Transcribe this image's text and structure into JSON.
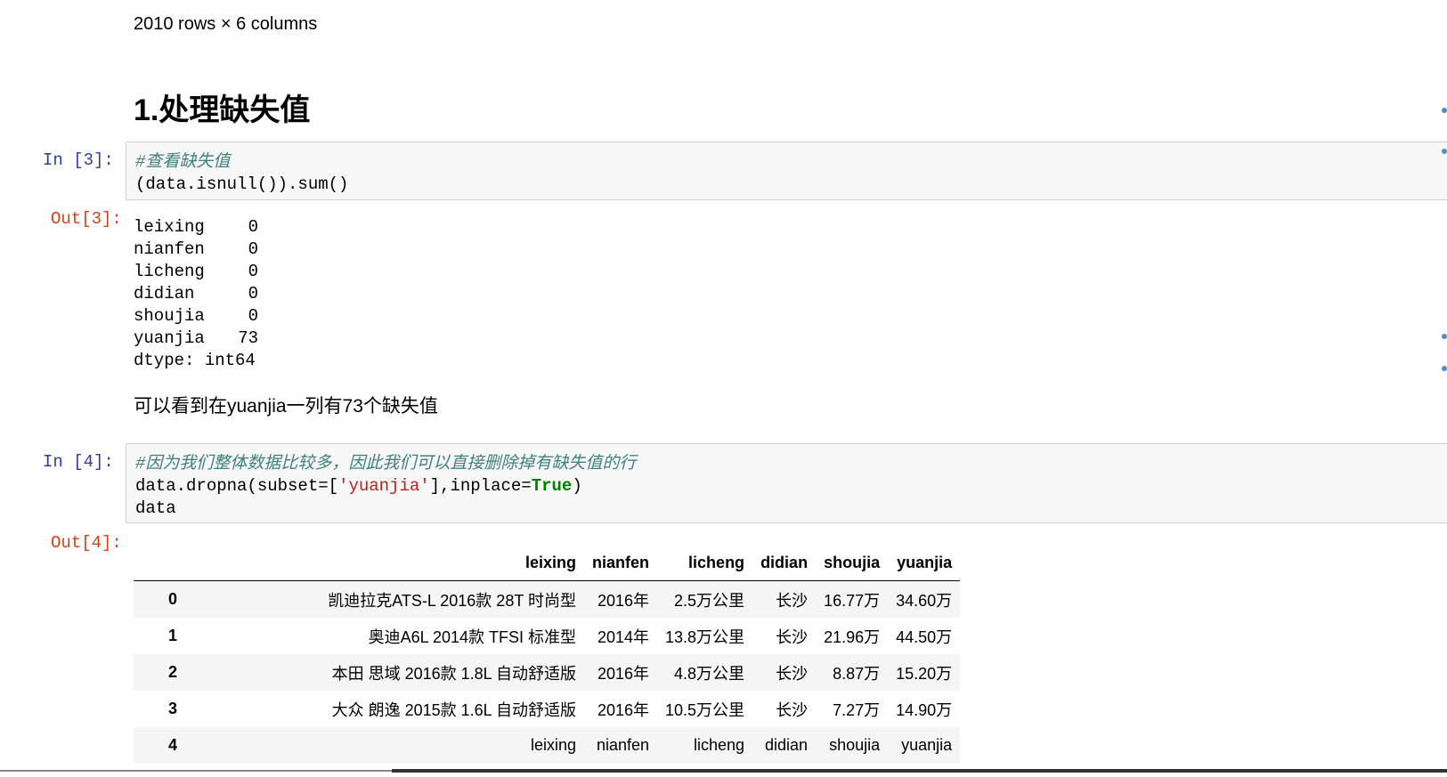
{
  "top_note": "2010 rows × 6 columns",
  "section_heading": "1.处理缺失值",
  "cell3": {
    "in_prompt": "In  [3]:",
    "out_prompt": "Out[3]:",
    "comment": "#查看缺失值",
    "code": "(data.isnull()).sum()",
    "output": [
      {
        "label": "leixing",
        "value": "0"
      },
      {
        "label": "nianfen",
        "value": "0"
      },
      {
        "label": "licheng",
        "value": "0"
      },
      {
        "label": "didian",
        "value": "0"
      },
      {
        "label": "shoujia",
        "value": "0"
      },
      {
        "label": "yuanjia",
        "value": "73"
      }
    ],
    "dtype_line": "dtype: int64"
  },
  "markdown_note": "可以看到在yuanjia一列有73个缺失值",
  "cell4": {
    "in_prompt": "In  [4]:",
    "out_prompt": "Out[4]:",
    "comment": "#因为我们整体数据比较多，因此我们可以直接删除掉有缺失值的行",
    "code_prefix": "data.dropna(subset=[",
    "code_string": "'yuanjia'",
    "code_middle": "],inplace=",
    "code_keyword": "True",
    "code_suffix": ")",
    "code_line3": "data"
  },
  "table": {
    "columns": [
      "leixing",
      "nianfen",
      "licheng",
      "didian",
      "shoujia",
      "yuanjia"
    ],
    "rows": [
      {
        "index": "0",
        "cells": [
          "凯迪拉克ATS-L 2016款 28T 时尚型",
          "2016年",
          "2.5万公里",
          "长沙",
          "16.77万",
          "34.60万"
        ]
      },
      {
        "index": "1",
        "cells": [
          "奥迪A6L 2014款 TFSI 标准型",
          "2014年",
          "13.8万公里",
          "长沙",
          "21.96万",
          "44.50万"
        ]
      },
      {
        "index": "2",
        "cells": [
          "本田 思域 2016款 1.8L 自动舒适版",
          "2016年",
          "4.8万公里",
          "长沙",
          "8.87万",
          "15.20万"
        ]
      },
      {
        "index": "3",
        "cells": [
          "大众 朗逸 2015款 1.6L 自动舒适版",
          "2016年",
          "10.5万公里",
          "长沙",
          "7.27万",
          "14.90万"
        ]
      },
      {
        "index": "4",
        "cells": [
          "leixing",
          "nianfen",
          "licheng",
          "didian",
          "shoujia",
          "yuanjia"
        ]
      }
    ]
  }
}
